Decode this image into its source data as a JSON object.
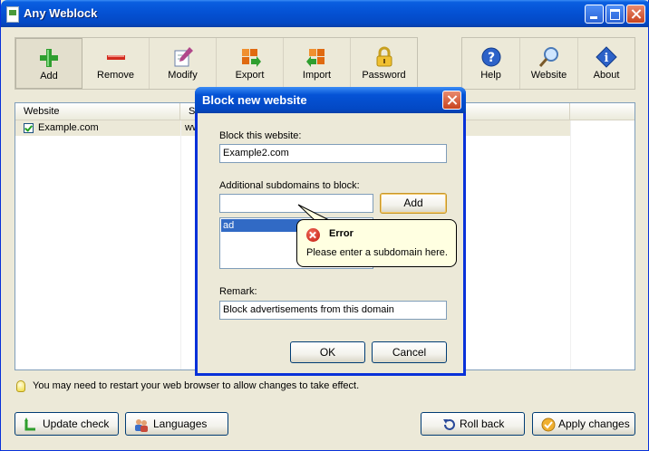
{
  "window": {
    "title": "Any Weblock"
  },
  "toolbar": {
    "left": [
      {
        "label": "Add",
        "icon": "add-icon"
      },
      {
        "label": "Remove",
        "icon": "remove-icon"
      },
      {
        "label": "Modify",
        "icon": "modify-icon"
      },
      {
        "label": "Export",
        "icon": "export-icon"
      },
      {
        "label": "Import",
        "icon": "import-icon"
      },
      {
        "label": "Password",
        "icon": "lock-icon"
      }
    ],
    "right": [
      {
        "label": "Help",
        "icon": "help-icon"
      },
      {
        "label": "Website",
        "icon": "website-icon"
      },
      {
        "label": "About",
        "icon": "about-icon"
      }
    ]
  },
  "list": {
    "columns": [
      "Website",
      "Su"
    ],
    "rows": [
      {
        "website": "Example.com",
        "sub": "ww",
        "checked": true
      }
    ]
  },
  "hint": "You may need to restart your web browser to allow changes to take effect.",
  "bottom": {
    "update": "Update check",
    "languages": "Languages",
    "rollback": "Roll back",
    "apply": "Apply changes"
  },
  "dialog": {
    "title": "Block new website",
    "block_label": "Block this website:",
    "block_value": "Example2.com",
    "sub_label": "Additional subdomains to block:",
    "sub_value": "",
    "add_button": "Add",
    "subdomains": [
      "ad"
    ],
    "remark_label": "Remark:",
    "remark_value": "Block advertisements from this domain",
    "ok": "OK",
    "cancel": "Cancel"
  },
  "tooltip": {
    "title": "Error",
    "message": "Please enter a subdomain here."
  },
  "colors": {
    "titlebar": "#0553D6",
    "selection": "#316AC5",
    "tooltip_bg": "#FFFFE1",
    "face": "#ECE9D8"
  }
}
